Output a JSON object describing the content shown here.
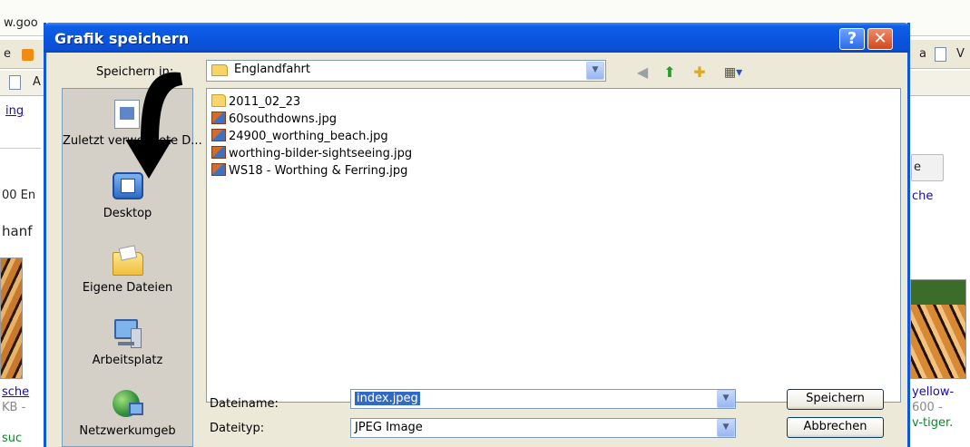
{
  "background": {
    "url": "w.goo",
    "links_bar": {
      "left_label": "e",
      "right_label": "a",
      "right_doc_label": "V"
    },
    "tabs_bar": {
      "left_label": "A"
    },
    "left_texts": [
      "ing",
      "00 En",
      "hanf",
      "sche",
      "KB -",
      "suc"
    ],
    "right_texts": {
      "button_label": "e",
      "link": "che",
      "yellow": "yellow-",
      "size": "600 -",
      "tiger": "v-tiger."
    }
  },
  "dialog": {
    "title": "Grafik speichern",
    "help_label": "?",
    "close_label": "✕",
    "save_in_label": "Speichern in:",
    "current_folder": "Englandfahrt",
    "places": [
      {
        "label": "Zuletzt verwendete D...",
        "icon": "recent-documents-icon"
      },
      {
        "label": "Desktop",
        "icon": "desktop-icon"
      },
      {
        "label": "Eigene Dateien",
        "icon": "my-documents-icon"
      },
      {
        "label": "Arbeitsplatz",
        "icon": "my-computer-icon"
      },
      {
        "label": "Netzwerkumgeb",
        "icon": "network-icon"
      }
    ],
    "files": [
      {
        "name": "2011_02_23",
        "type": "folder"
      },
      {
        "name": "60southdowns.jpg",
        "type": "jpg"
      },
      {
        "name": "24900_worthing_beach.jpg",
        "type": "jpg"
      },
      {
        "name": "worthing-bilder-sightseeing.jpg",
        "type": "jpg"
      },
      {
        "name": "WS18 - Worthing & Ferring.jpg",
        "type": "jpg"
      }
    ],
    "filename_label": "Dateiname:",
    "filename_value": "index.jpeg",
    "filetype_label": "Dateityp:",
    "filetype_value": "JPEG Image",
    "save_button": "Speichern",
    "cancel_button": "Abbrechen",
    "colors": {
      "titlebar": "#0a55df",
      "dialog_bg": "#ece9d8",
      "selection": "#316ac5"
    }
  },
  "overlay": {
    "arrow_icon": "curved-arrow-down"
  }
}
